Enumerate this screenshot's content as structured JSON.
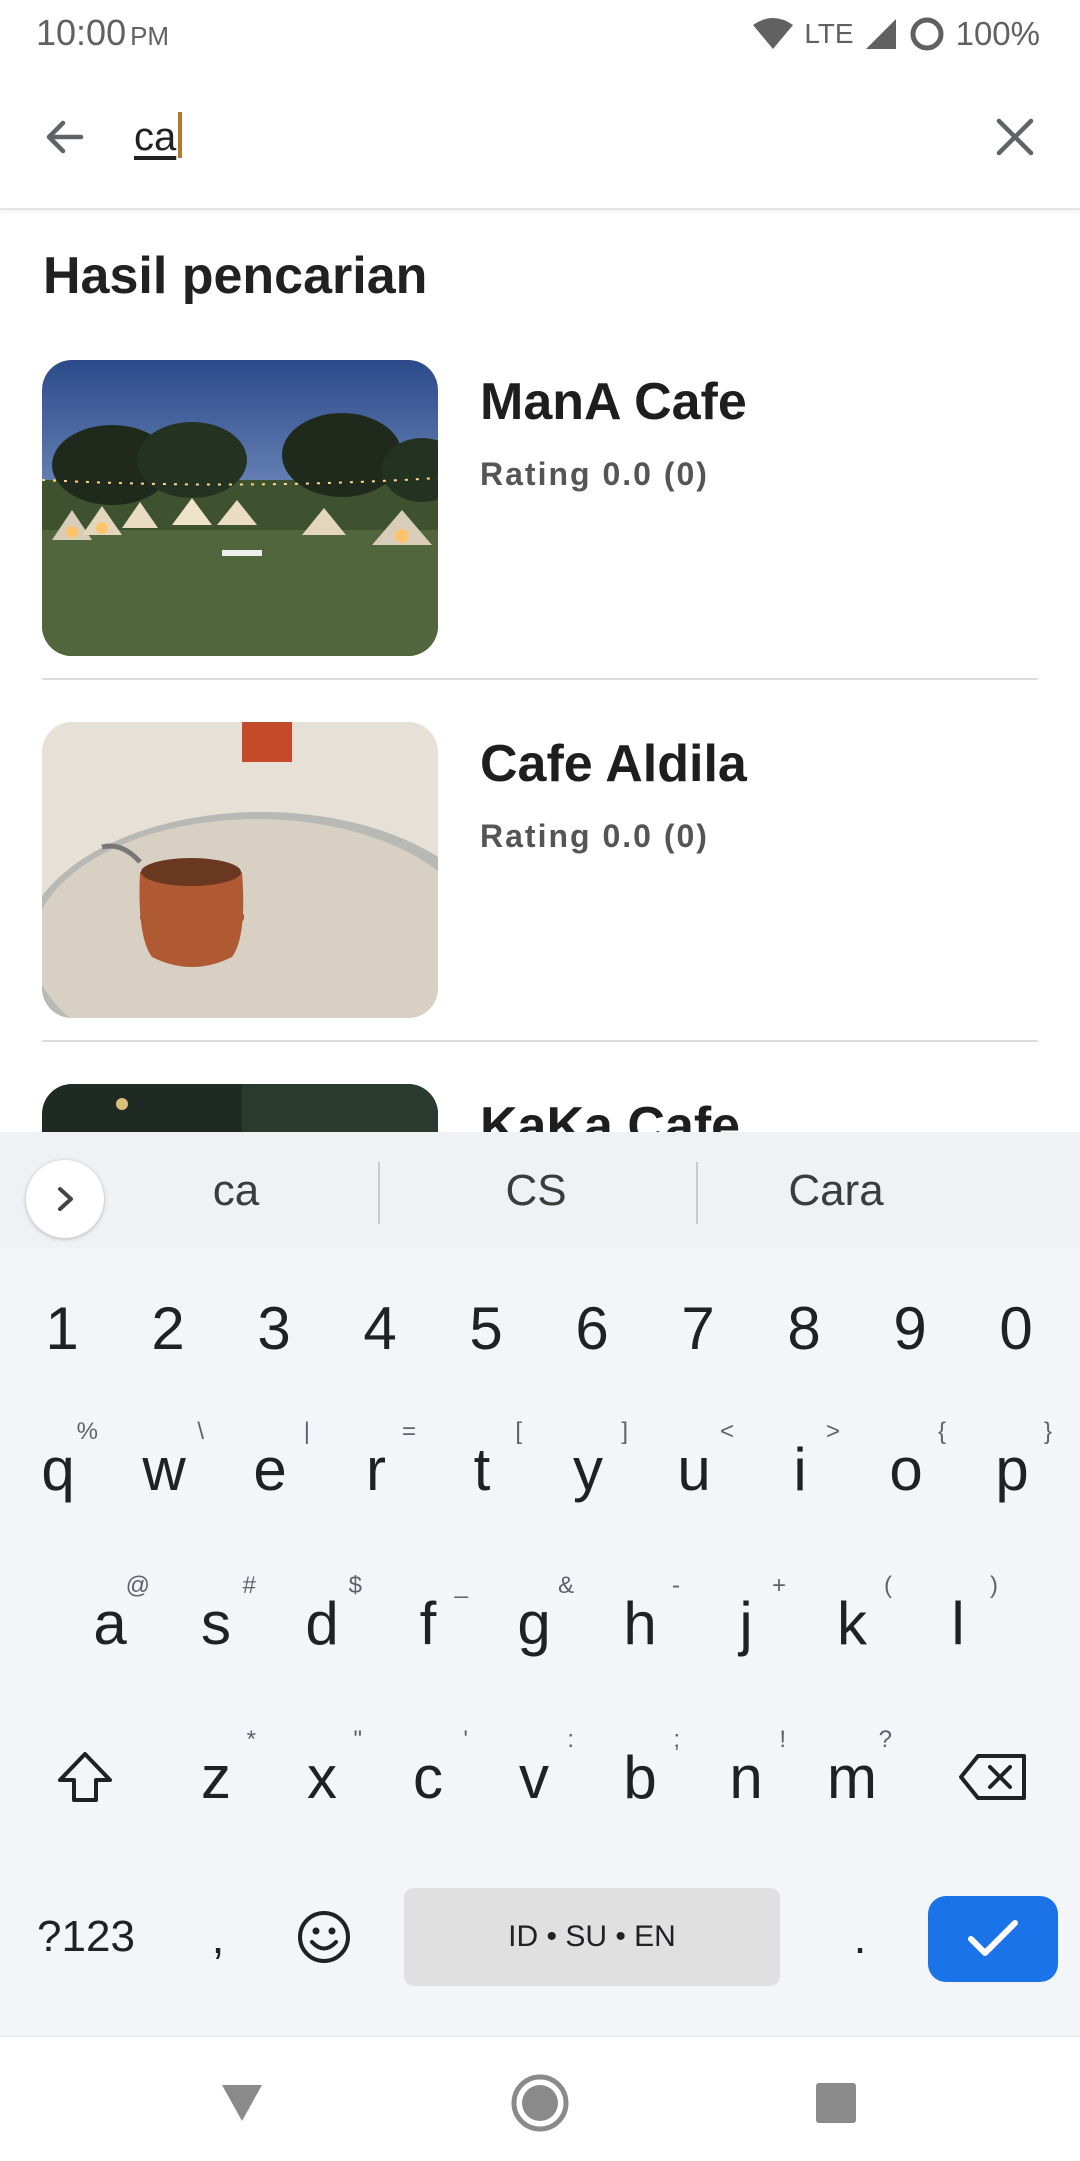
{
  "status_bar": {
    "time": "10:00",
    "ampm": "PM",
    "network": "LTE",
    "battery": "100%"
  },
  "search": {
    "query": "ca"
  },
  "section_title": "Hasil pencarian",
  "results": [
    {
      "name": "ManA Cafe",
      "rating": "Rating 0.0 (0)"
    },
    {
      "name": "Cafe Aldila",
      "rating": "Rating 0.0 (0)"
    },
    {
      "name": "KaKa Cafe",
      "rating": ""
    }
  ],
  "keyboard": {
    "suggestions": [
      "ca",
      "CS",
      "Cara"
    ],
    "digits": [
      "1",
      "2",
      "3",
      "4",
      "5",
      "6",
      "7",
      "8",
      "9",
      "0"
    ],
    "row1": [
      {
        "key": "q",
        "hint": "%"
      },
      {
        "key": "w",
        "hint": "\\"
      },
      {
        "key": "e",
        "hint": "|"
      },
      {
        "key": "r",
        "hint": "="
      },
      {
        "key": "t",
        "hint": "["
      },
      {
        "key": "y",
        "hint": "]"
      },
      {
        "key": "u",
        "hint": "<"
      },
      {
        "key": "i",
        "hint": ">"
      },
      {
        "key": "o",
        "hint": "{"
      },
      {
        "key": "p",
        "hint": "}"
      }
    ],
    "row2": [
      {
        "key": "a",
        "hint": "@"
      },
      {
        "key": "s",
        "hint": "#"
      },
      {
        "key": "d",
        "hint": "$"
      },
      {
        "key": "f",
        "hint": "_"
      },
      {
        "key": "g",
        "hint": "&"
      },
      {
        "key": "h",
        "hint": "-"
      },
      {
        "key": "j",
        "hint": "+"
      },
      {
        "key": "k",
        "hint": "("
      },
      {
        "key": "l",
        "hint": ")"
      }
    ],
    "row3": [
      {
        "key": "z",
        "hint": "*"
      },
      {
        "key": "x",
        "hint": "\""
      },
      {
        "key": "c",
        "hint": "'"
      },
      {
        "key": "v",
        "hint": ":"
      },
      {
        "key": "b",
        "hint": ";"
      },
      {
        "key": "n",
        "hint": "!"
      },
      {
        "key": "m",
        "hint": "?"
      }
    ],
    "symbols_label": "?123",
    "comma": ",",
    "period": ".",
    "space_label": "ID • SU • EN"
  },
  "colors": {
    "enter_key": "#1a73e8",
    "caret": "#b07a2a"
  }
}
